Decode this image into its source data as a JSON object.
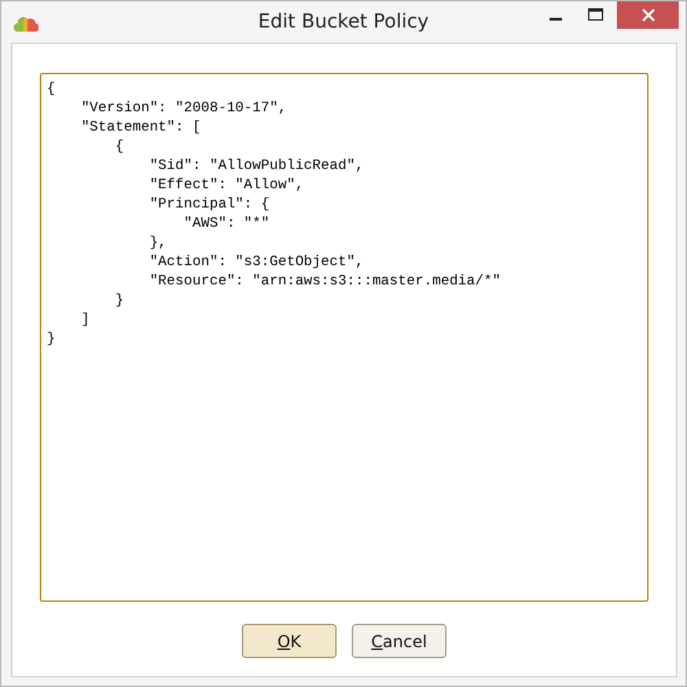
{
  "window": {
    "title": "Edit Bucket Policy"
  },
  "editor": {
    "value": "{\n    \"Version\": \"2008-10-17\",\n    \"Statement\": [\n        {\n            \"Sid\": \"AllowPublicRead\",\n            \"Effect\": \"Allow\",\n            \"Principal\": {\n                \"AWS\": \"*\"\n            },\n            \"Action\": \"s3:GetObject\",\n            \"Resource\": \"arn:aws:s3:::master.media/*\"\n        }\n    ]\n}"
  },
  "buttons": [
    {
      "label": "OK",
      "access_key_underlined": true,
      "default": true
    },
    {
      "label": "Cancel",
      "access_key_underlined": true,
      "default": false
    }
  ]
}
